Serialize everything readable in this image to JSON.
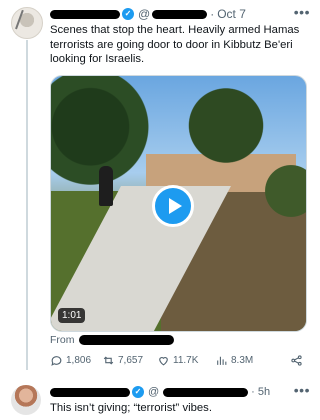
{
  "tweet": {
    "handle_prefix": "@",
    "time": "Oct 7",
    "dot": "·",
    "text": "Scenes that stop the heart. Heavily armed Hamas terrorists are going door to door in Kibbutz Be'eri looking for Israelis.",
    "video": {
      "duration": "1:01"
    },
    "from_label": "From",
    "stats": {
      "replies": "1,806",
      "reposts": "7,657",
      "likes": "11.7K",
      "views": "8.3M"
    }
  },
  "reply": {
    "handle_prefix": "@",
    "time": "5h",
    "dot": "·",
    "text": "This isn’t giving; “terrorist” vibes."
  },
  "icons": [
    "more-icon",
    "verified-icon",
    "play-icon",
    "reply-icon",
    "repost-icon",
    "like-icon",
    "views-icon",
    "share-icon"
  ],
  "colors": {
    "accent": "#1d9bf0",
    "muted": "#536471"
  }
}
